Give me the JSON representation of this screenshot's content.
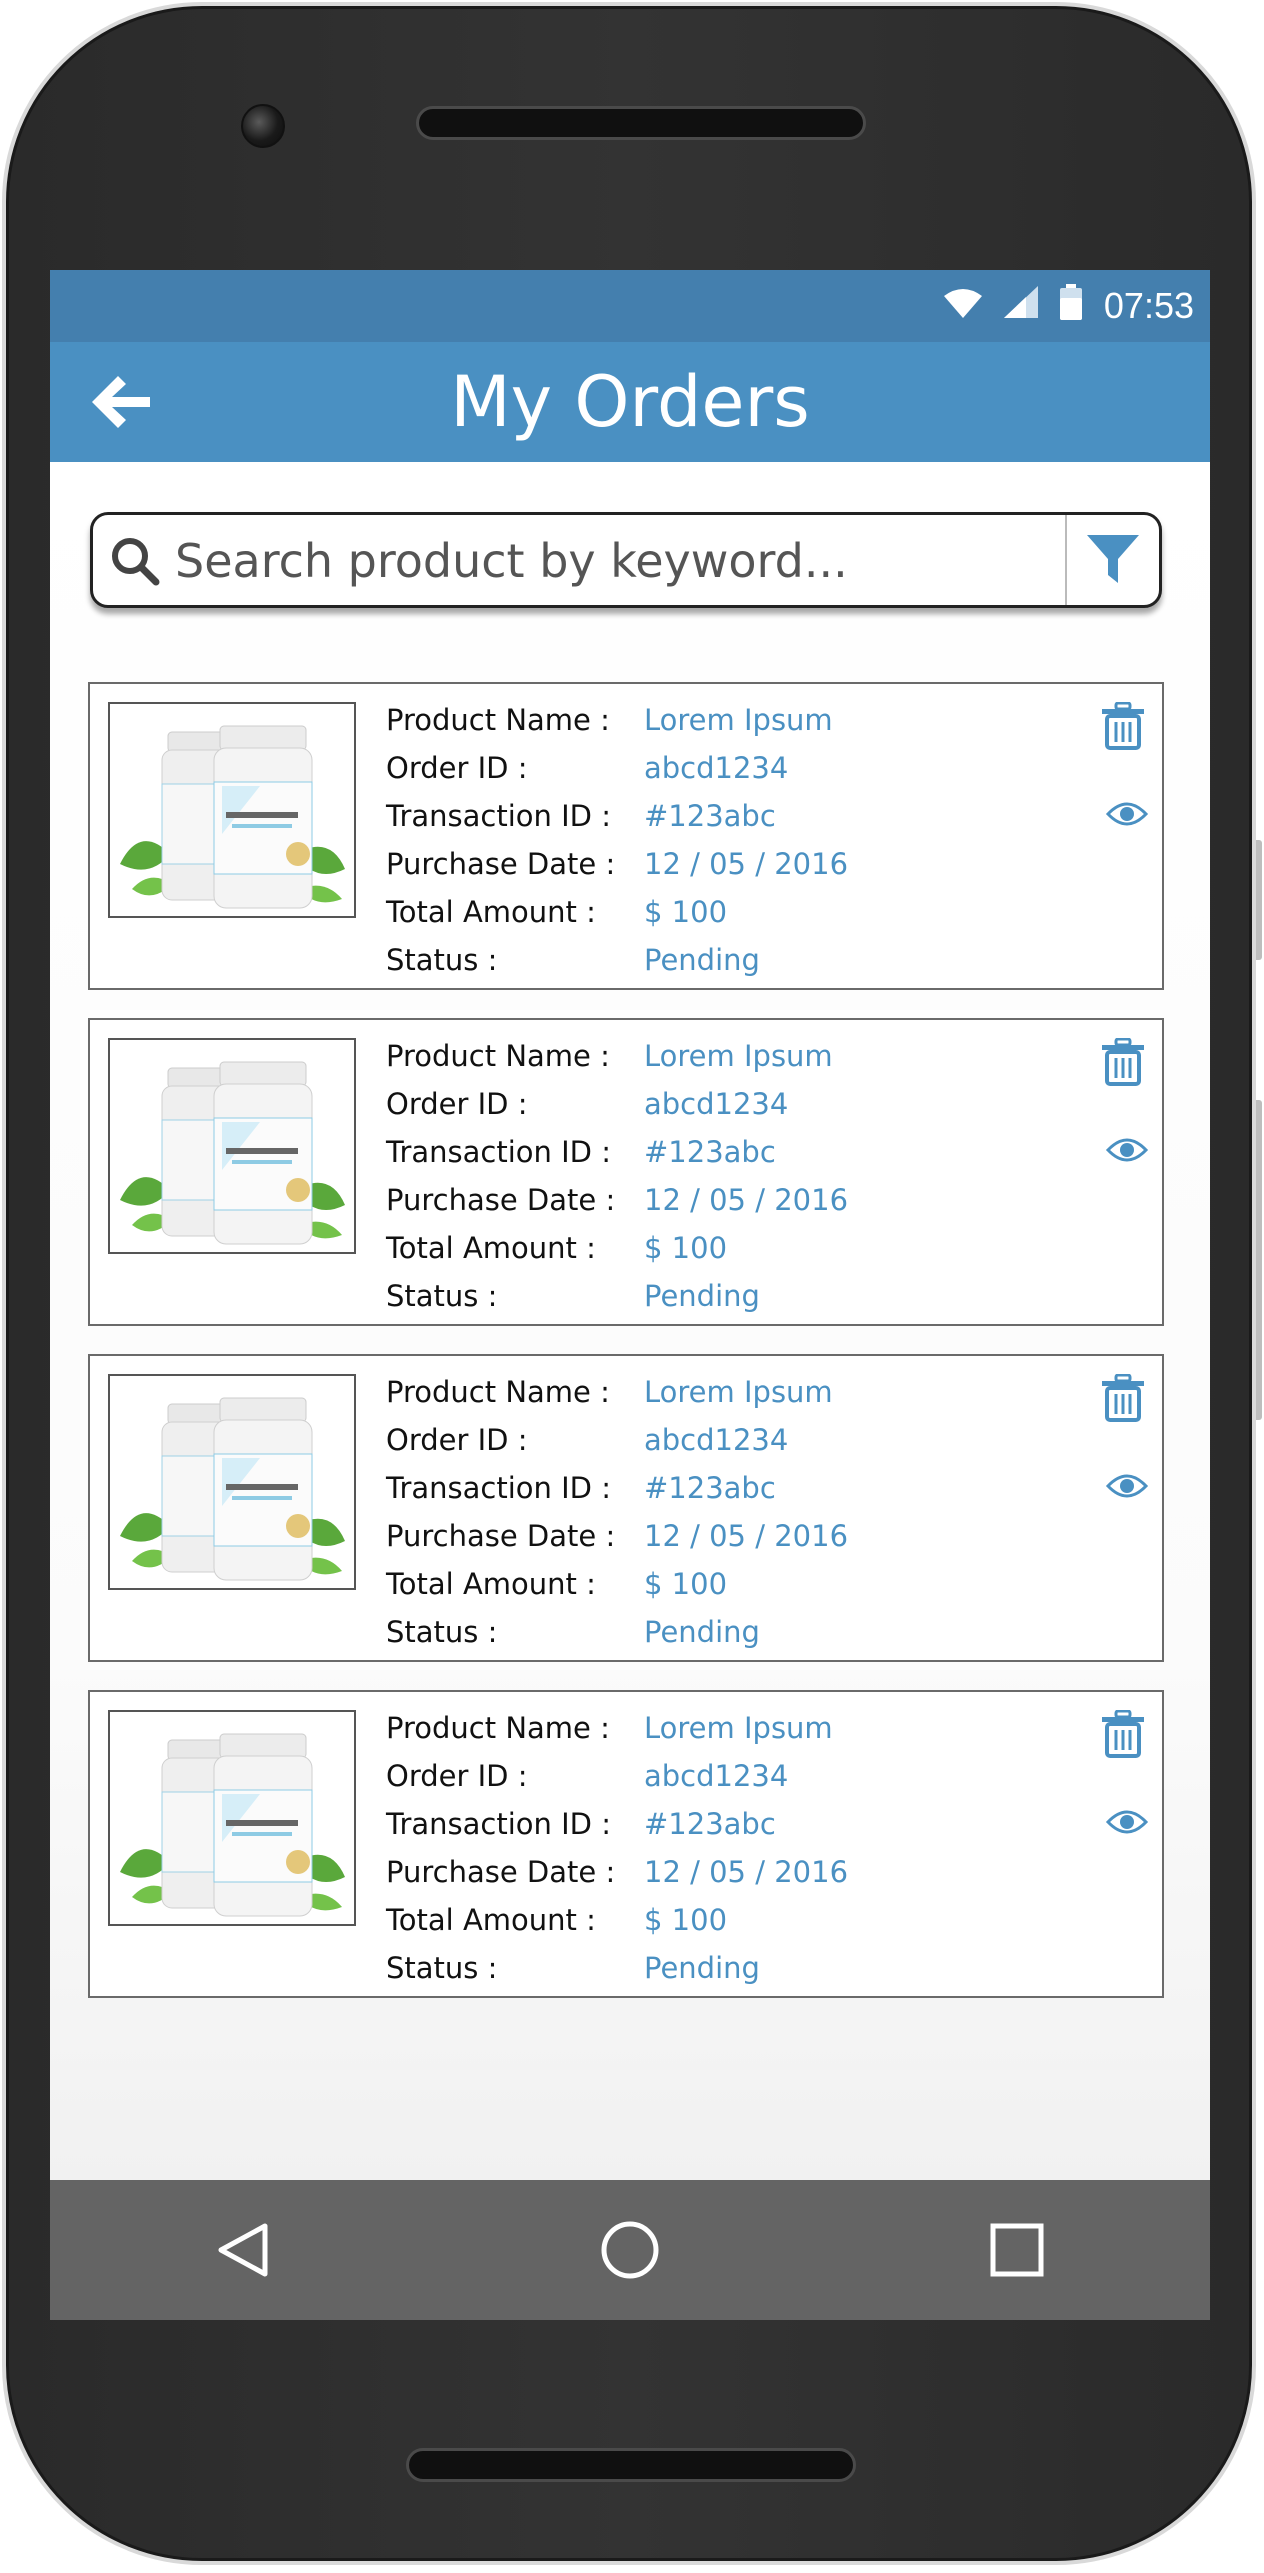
{
  "status_bar": {
    "time": "07:53"
  },
  "app_bar": {
    "title": "My Orders"
  },
  "search": {
    "placeholder": "Search product by keyword...",
    "value": ""
  },
  "labels": {
    "product_name": "Product Name :",
    "order_id": "Order ID :",
    "transaction_id": "Transaction ID :",
    "purchase_date": "Purchase Date :",
    "total_amount": "Total Amount :",
    "status": "Status :"
  },
  "orders": [
    {
      "product_name": "Lorem Ipsum",
      "order_id": "abcd1234",
      "transaction_id": "#123abc",
      "purchase_date": "12 / 05 / 2016",
      "total_amount": "$ 100",
      "status": "Pending"
    },
    {
      "product_name": "Lorem Ipsum",
      "order_id": "abcd1234",
      "transaction_id": "#123abc",
      "purchase_date": "12 / 05 / 2016",
      "total_amount": "$ 100",
      "status": "Pending"
    },
    {
      "product_name": "Lorem Ipsum",
      "order_id": "abcd1234",
      "transaction_id": "#123abc",
      "purchase_date": "12 / 05 / 2016",
      "total_amount": "$ 100",
      "status": "Pending"
    },
    {
      "product_name": "Lorem Ipsum",
      "order_id": "abcd1234",
      "transaction_id": "#123abc",
      "purchase_date": "12 / 05 / 2016",
      "total_amount": "$ 100",
      "status": "Pending"
    }
  ],
  "icons": {
    "back": "arrow-left-icon",
    "search": "magnifier-icon",
    "filter": "funnel-icon",
    "delete": "trash-icon",
    "view": "eye-icon",
    "nav_back": "triangle-back-icon",
    "nav_home": "circle-home-icon",
    "nav_recents": "square-recents-icon"
  },
  "colors": {
    "accent": "#4a90c2",
    "status_bar": "#447fae",
    "nav_bar": "#646464",
    "device_body": "#2e2e2e"
  }
}
